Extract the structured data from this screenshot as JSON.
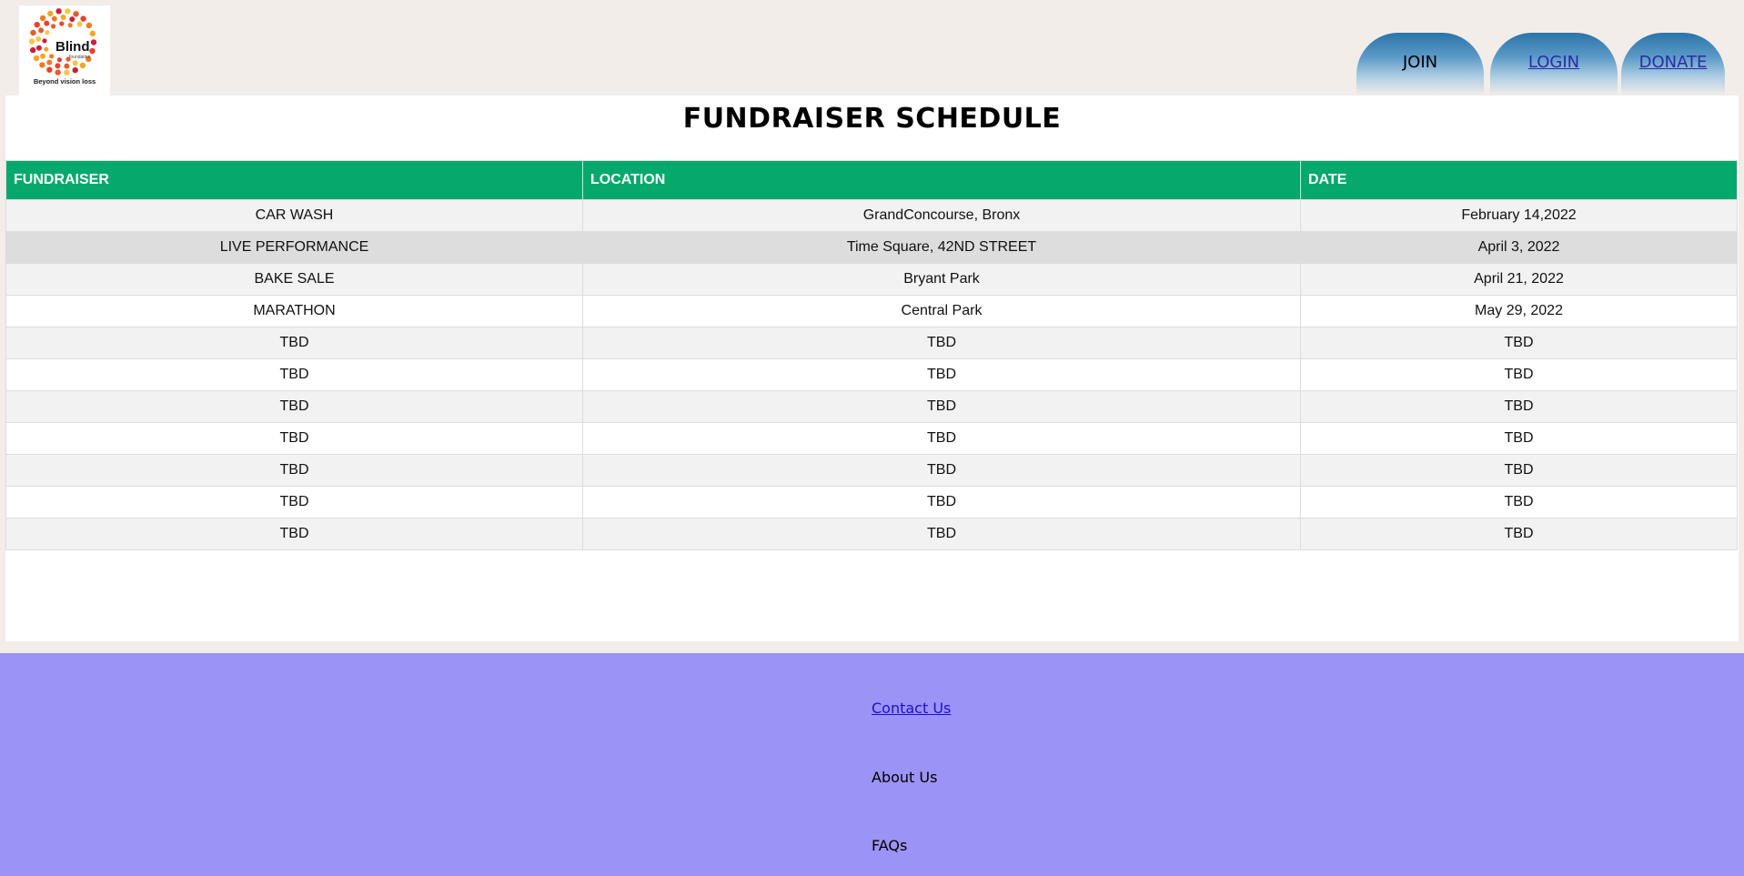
{
  "logo": {
    "brand": "Blind",
    "sub": "foundation",
    "tagline": "Beyond vision loss"
  },
  "nav": {
    "join": "JOIN",
    "login": "LOGIN",
    "donate": "DONATE"
  },
  "page": {
    "title": "FUNDRAISER SCHEDULE"
  },
  "table": {
    "headers": [
      "FUNDRAISER",
      "LOCATION",
      "DATE"
    ],
    "rows": [
      [
        "CAR WASH",
        "GrandConcourse, Bronx",
        "February 14,2022"
      ],
      [
        "LIVE PERFORMANCE",
        "Time Square, 42ND STREET",
        "April 3, 2022"
      ],
      [
        "BAKE SALE",
        "Bryant Park",
        "April 21, 2022"
      ],
      [
        "MARATHON",
        "Central Park",
        "May 29, 2022"
      ],
      [
        "TBD",
        "TBD",
        "TBD"
      ],
      [
        "TBD",
        "TBD",
        "TBD"
      ],
      [
        "TBD",
        "TBD",
        "TBD"
      ],
      [
        "TBD",
        "TBD",
        "TBD"
      ],
      [
        "TBD",
        "TBD",
        "TBD"
      ],
      [
        "TBD",
        "TBD",
        "TBD"
      ],
      [
        "TBD",
        "TBD",
        "TBD"
      ]
    ]
  },
  "footer": {
    "contact": "Contact Us",
    "about": "About Us",
    "faqs": "FAQs"
  },
  "colors": {
    "header_bg": "#f2ede9",
    "table_header": "#05a96b",
    "nav_tab": "#2a74a8",
    "footer_bg": "#9b93f5",
    "link": "#1c0fd6"
  }
}
